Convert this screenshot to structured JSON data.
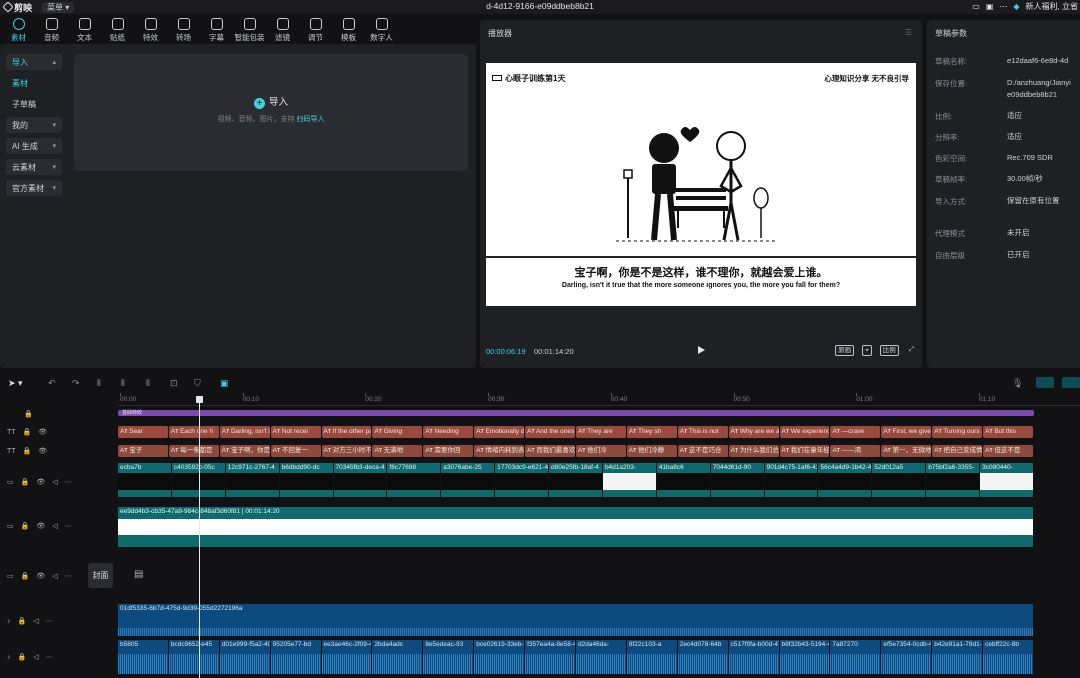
{
  "titlebar": {
    "app_name": "剪映",
    "menu_label": "菜单",
    "doc_name": "d-4d12-9166-e09ddbeb8b21",
    "promo": "新人福利, 立省"
  },
  "toolbar": {
    "items": [
      {
        "label": "素材"
      },
      {
        "label": "音频"
      },
      {
        "label": "文本"
      },
      {
        "label": "贴纸"
      },
      {
        "label": "特效"
      },
      {
        "label": "转场"
      },
      {
        "label": "字幕"
      },
      {
        "label": "智能包装"
      },
      {
        "label": "滤镜"
      },
      {
        "label": "调节"
      },
      {
        "label": "模板"
      },
      {
        "label": "数字人"
      }
    ]
  },
  "left_nav": {
    "items": [
      {
        "label": "导入",
        "expand": "▴"
      },
      {
        "label": "素材",
        "expand": ""
      },
      {
        "label": "子草稿",
        "expand": ""
      },
      {
        "label": "我的",
        "expand": "▾"
      },
      {
        "label": "AI 生成",
        "expand": "▾"
      },
      {
        "label": "云素材",
        "expand": "▾"
      },
      {
        "label": "官方素材",
        "expand": "▾"
      }
    ]
  },
  "import": {
    "button_label": "导入",
    "hint": "视频、音频、图片，支持",
    "hint_link": "扫码导入"
  },
  "player": {
    "header": "播放器",
    "title_left": "心眼子训练第1天",
    "title_right": "心理知识分享  无不良引导",
    "subtitle_zh": "宝子啊，你是不是这样，谁不理你，就越会爱上谁。",
    "subtitle_en": "Darling, isn't it true that the more someone ignores you, the more you fall for them?",
    "current_time": "00:00:06:19",
    "total_time": "00:01:14:20",
    "btn_full": "原画",
    "btn_ratio": "比例"
  },
  "params": {
    "header": "草稿参数",
    "rows": [
      {
        "k": "草稿名称:",
        "v": "e12daaf6-6e8d-4d"
      },
      {
        "k": "保存位置:",
        "v": "D:/anzhuang/Jianyi"
      },
      {
        "k": "",
        "v": "e09ddbeb8b21"
      },
      {
        "k": "比例:",
        "v": "适应"
      },
      {
        "k": "分辨率:",
        "v": "适应"
      },
      {
        "k": "色彩空间:",
        "v": "Rec.709 SDR"
      },
      {
        "k": "草稿帧率:",
        "v": "30.00帧/秒"
      },
      {
        "k": "导入方式:",
        "v": "保留在原有位置"
      },
      {
        "k": "代理模式",
        "v": "未开启"
      },
      {
        "k": "自由层级",
        "v": "已开启"
      }
    ]
  },
  "ruler": {
    "ticks": [
      "00:00",
      "00:10",
      "00:20",
      "00:30",
      "00:40",
      "00:50",
      "01:00",
      "01:10"
    ]
  },
  "tracks": {
    "effect_label": "基础特效",
    "text1": [
      "Sear",
      "Each one h",
      "Darling, isn't it",
      "Not recei",
      "If the other pa",
      "Giving",
      "Needing",
      "Emotionally drained",
      "And the ones",
      "They are",
      "They sh",
      "This is not",
      "Why are we al",
      "We experience",
      "—crave",
      "First, we give",
      "Turning ours",
      "But this"
    ],
    "text2": [
      "宝子",
      "每一条都是",
      "宝子啊，你是不",
      "不回复一",
      "对方三小时不回",
      "无满地",
      "需要你回",
      "情绪内耗到表三点",
      "而我们最喜欢的",
      "他们冷",
      "他们冷静",
      "这不是巧合",
      "为什么我们总喜",
      "我们在童年经历",
      "——渴",
      "第一，无微地付",
      "把自己变成情",
      "但这不是"
    ],
    "video": [
      "ecba7b",
      "c403592c-05c",
      "12c971c-2767-4",
      "b6dbdd90-dc",
      "70345fb3-deca-4",
      "f8c77698",
      "a3076abe-25",
      "17703dc9-e621-49b7-",
      "d80e25fb-18af-4",
      "b4d1a203-",
      "41ba8c6",
      "7044d61d-90",
      "901d4c75-1af6-43",
      "56c4a4d9-1b42-4",
      "52d012a5",
      "b75bf2a6-3355-",
      "3c080440-"
    ],
    "video2_label": "ee9dd4b3-cb35-47a9-984c-848af3d60f81",
    "video2_duration": "00:01:14:20",
    "cover_label": "封面",
    "audio1_label": "01df5335-6b7d-475d-9d39-055d2272196a",
    "audio2": [
      "b5805",
      "bcdc9652-e45",
      "d01e999-f5a2-40",
      "95205e77-bd",
      "ee3ae46c-2f09-4",
      "2bda4adc",
      "8e5edeac-93",
      "bce02619-33eb-4497-8",
      "f357ea4a-8e58-4c",
      "d2da46da-",
      "8f22c103-a",
      "2ec4d078-64b",
      "c517f9fa-b00d-47a",
      "b9f32b43-5194-45",
      "7a87270",
      "ef5e7354-0cdb-4a",
      "b42e91a1-79d1-",
      "cebff22c-8b"
    ]
  }
}
